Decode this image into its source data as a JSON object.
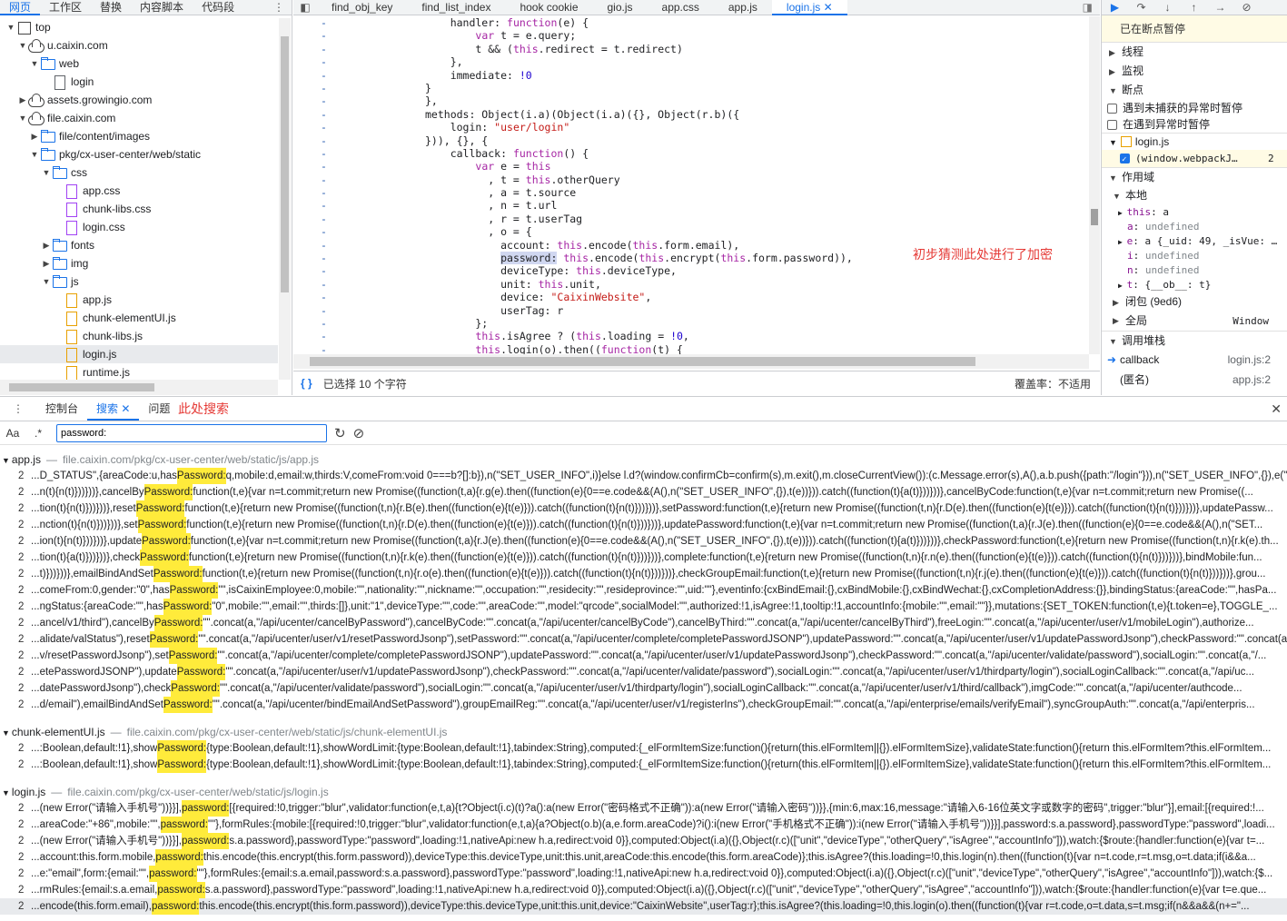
{
  "navigator": {
    "tabs": [
      "网页",
      "工作区",
      "替换",
      "内容脚本",
      "代码段"
    ],
    "active_tab": "网页",
    "tree": [
      {
        "label": "top",
        "depth": 0,
        "kind": "page",
        "expanded": true
      },
      {
        "label": "u.caixin.com",
        "depth": 1,
        "kind": "cloud",
        "expanded": true
      },
      {
        "label": "web",
        "depth": 2,
        "kind": "folder",
        "expanded": true
      },
      {
        "label": "login",
        "depth": 3,
        "kind": "file"
      },
      {
        "label": "assets.growingio.com",
        "depth": 1,
        "kind": "cloud",
        "expanded": false
      },
      {
        "label": "file.caixin.com",
        "depth": 1,
        "kind": "cloud",
        "expanded": true
      },
      {
        "label": "file/content/images",
        "depth": 2,
        "kind": "folder",
        "expanded": false
      },
      {
        "label": "pkg/cx-user-center/web/static",
        "depth": 2,
        "kind": "folder",
        "expanded": true
      },
      {
        "label": "css",
        "depth": 3,
        "kind": "folder",
        "expanded": true
      },
      {
        "label": "app.css",
        "depth": 4,
        "kind": "file-p"
      },
      {
        "label": "chunk-libs.css",
        "depth": 4,
        "kind": "file-p"
      },
      {
        "label": "login.css",
        "depth": 4,
        "kind": "file-p"
      },
      {
        "label": "fonts",
        "depth": 3,
        "kind": "folder",
        "expanded": false
      },
      {
        "label": "img",
        "depth": 3,
        "kind": "folder",
        "expanded": false
      },
      {
        "label": "js",
        "depth": 3,
        "kind": "folder",
        "expanded": true
      },
      {
        "label": "app.js",
        "depth": 4,
        "kind": "file-y"
      },
      {
        "label": "chunk-elementUI.js",
        "depth": 4,
        "kind": "file-y"
      },
      {
        "label": "chunk-libs.js",
        "depth": 4,
        "kind": "file-y"
      },
      {
        "label": "login.js",
        "depth": 4,
        "kind": "file-y",
        "selected": true
      },
      {
        "label": "runtime.js",
        "depth": 4,
        "kind": "file-y"
      }
    ]
  },
  "editor": {
    "tabs": [
      "find_obj_key",
      "find_list_index",
      "hook cookie",
      "gio.js",
      "app.css",
      "app.js",
      "login.js"
    ],
    "active_tab": "login.js",
    "code_lines": [
      {
        "text": "    handler: function(e) {"
      },
      {
        "text": "        var t = e.query;"
      },
      {
        "text": "        t && (this.redirect = t.redirect)"
      },
      {
        "text": "    },"
      },
      {
        "text": "    immediate: !0"
      },
      {
        "text": "}"
      },
      {
        "text": "},"
      },
      {
        "text": "methods: Object(i.a)(Object(i.a)({}, Object(r.b)({"
      },
      {
        "text": "    login: \"user/login\""
      },
      {
        "text": "})), {}, {"
      },
      {
        "text": "    callback: function() {"
      },
      {
        "text": "        var e = this"
      },
      {
        "text": "          , t = this.otherQuery"
      },
      {
        "text": "          , a = t.source"
      },
      {
        "text": "          , n = t.url"
      },
      {
        "text": "          , r = t.userTag"
      },
      {
        "text": "          , o = {"
      },
      {
        "text": "            account: this.encode(this.form.email),"
      },
      {
        "text": "            password: this.encode(this.encrypt(this.form.password)),"
      },
      {
        "text": "            deviceType: this.deviceType,"
      },
      {
        "text": "            unit: this.unit,"
      },
      {
        "text": "            device: \"CaixinWebsite\","
      },
      {
        "text": "            userTag: r"
      },
      {
        "text": "        };"
      },
      {
        "text": "        this.isAgree ? (this.loading = !0,"
      },
      {
        "text": "        this.login(o).then((function(t) {"
      }
    ],
    "annotation": "初步猜测此处进行了加密",
    "status_selected": "已选择 10 个字符",
    "status_coverage": "覆盖率：不适用"
  },
  "debugger": {
    "paused_label": "已在断点暂停",
    "sections": {
      "threads": "线程",
      "watch": "监视",
      "breakpoints": "断点",
      "pause_uncaught": "遇到未捕获的异常时暂停",
      "pause_caught": "在遇到异常时暂停",
      "bp_file": "login.js",
      "bp_code": "(window.webpackJ…",
      "bp_line": "2",
      "scope": "作用域",
      "local": "本地",
      "closure": "闭包 (9ed6)",
      "global": "全局",
      "global_value": "Window",
      "callstack": "调用堆栈"
    },
    "scope_vars": [
      {
        "key": "this",
        "value": "a",
        "expandable": true
      },
      {
        "key": "a",
        "value": "undefined"
      },
      {
        "key": "e",
        "value": "a {_uid: 49, _isVue: …",
        "expandable": true
      },
      {
        "key": "i",
        "value": "undefined"
      },
      {
        "key": "n",
        "value": "undefined"
      },
      {
        "key": "t",
        "value": "{__ob__: t}",
        "expandable": true
      }
    ],
    "stack": [
      {
        "fn": "callback",
        "loc": "login.js:2",
        "current": true
      },
      {
        "fn": "(匿名)",
        "loc": "app.js:2"
      }
    ]
  },
  "drawer": {
    "tabs": [
      "控制台",
      "搜索",
      "问题"
    ],
    "active_tab": "搜索",
    "annotation": "此处搜索",
    "search_case": "Aa",
    "search_regex": ".*",
    "search_query": "password:"
  },
  "results": [
    {
      "file": "app.js",
      "path": "file.caixin.com/pkg/cx-user-center/web/static/js/app.js",
      "lines": [
        {
          "n": "2",
          "pre": "...D_STATUS\",{areaCode:u,has",
          "match": "Password:",
          "post": "q,mobile:d,email:w,thirds:V,comeFrom:void 0===b?[]:b}),n(\"SET_USER_INFO\",i)}else l.d?(window.confirmCb=confirm(s),m.exit(),m.closeCurrentView()):(c.Message.error(s),A(),a.b.push({path:\"/login\"})),n(\"SET_USER_INFO\",{}),e(\"c..."
        },
        {
          "n": "2",
          "pre": "...n(t){n(t)}))}))},cancelBy",
          "match": "Password:",
          "post": "function(t,e){var n=t.commit;return new Promise((function(t,a){r.g(e).then((function(e){0==e.code&&(A(),n(\"SET_USER_INFO\",{}),t(e))})).catch((function(t){a(t)}))}))},cancelByCode:function(t,e){var n=t.commit;return new Promise((..."
        },
        {
          "n": "2",
          "pre": "...tion(t){n(t)}))}))},reset",
          "match": "Password:",
          "post": "function(t,e){return new Promise((function(t,n){r.B(e).then((function(e){t(e)})).catch((function(t){n(t)}))}))},setPassword:function(t,e){return new Promise((function(t,n){r.D(e).then((function(e){t(e)})).catch((function(t){n(t)}))}))},updatePassw..."
        },
        {
          "n": "2",
          "pre": "...nction(t){n(t)}))}))},set",
          "match": "Password:",
          "post": "function(t,e){return new Promise((function(t,n){r.D(e).then((function(e){t(e)})).catch((function(t){n(t)}))}))},updatePassword:function(t,e){var n=t.commit;return new Promise((function(t,a){r.J(e).then((function(e){0==e.code&&(A(),n(\"SET..."
        },
        {
          "n": "2",
          "pre": "...ion(t){n(t)}))}))},update",
          "match": "Password:",
          "post": "function(t,e){var n=t.commit;return new Promise((function(t,a){r.J(e).then((function(e){0==e.code&&(A(),n(\"SET_USER_INFO\",{}),t(e))})).catch((function(t){a(t)}))}))},checkPassword:function(t,e){return new Promise((function(t,n){r.k(e).th..."
        },
        {
          "n": "2",
          "pre": "...tion(t){a(t)}))}))},check",
          "match": "Password:",
          "post": "function(t,e){return new Promise((function(t,n){r.k(e).then((function(e){t(e)})).catch((function(t){n(t)}))}))},complete:function(t,e){return new Promise((function(t,n){r.n(e).then((function(e){t(e)})).catch((function(t){n(t)}))}))},bindMobile:fun..."
        },
        {
          "n": "2",
          "pre": "...t)}))}))},emailBindAndSet",
          "match": "Password:",
          "post": "function(t,e){return new Promise((function(t,n){r.o(e).then((function(e){t(e)})).catch((function(t){n(t)}))}))},checkGroupEmail:function(t,e){return new Promise((function(t,n){r.j(e).then((function(e){t(e)})).catch((function(t){n(t)}))}))},grou..."
        },
        {
          "n": "2",
          "pre": "...comeFrom:0,gender:\"0\",has",
          "match": "Password:",
          "post": "\"\",isCaixinEmployee:0,mobile:\"\",nationality:\"\",nickname:\"\",occupation:\"\",residecity:\"\",resideprovince:\"\",uid:\"\"},eventinfo:{cxBindEmail:{},cxBindMobile:{},cxBindWechat:{},cxCompletionAddress:{}},bindingStatus:{areaCode:\"\",hasPa..."
        },
        {
          "n": "2",
          "pre": "...ngStatus:{areaCode:\"\",has",
          "match": "Password:",
          "post": "\"0\",mobile:\"\",email:\"\",thirds:[]},unit:\"1\",deviceType:\"\",code:\"\",areaCode:\"\",model:\"qrcode\",socialModel:\"\",authorized:!1,isAgree:!1,tooltip:!1,accountInfo:{mobile:\"\",email:\"\"}},mutations:{SET_TOKEN:function(t,e){t.token=e},TOGGLE_..."
        },
        {
          "n": "2",
          "pre": "...ancel/v1/third\"),cancelBy",
          "match": "Password:",
          "post": "\"\".concat(a,\"/api/ucenter/cancelByPassword\"),cancelByCode:\"\".concat(a,\"/api/ucenter/cancelByCode\"),cancelByThird:\"\".concat(a,\"/api/ucenter/cancelByThird\"),freeLogin:\"\".concat(a,\"/api/ucenter/user/v1/mobileLogin\"),authorize..."
        },
        {
          "n": "2",
          "pre": "...alidate/valStatus\"),reset",
          "match": "Password:",
          "post": "\"\".concat(a,\"/api/ucenter/user/v1/resetPasswordJsonp\"),setPassword:\"\".concat(a,\"/api/ucenter/complete/completePasswordJSONP\"),updatePassword:\"\".concat(a,\"/api/ucenter/user/v1/updatePasswordJsonp\"),checkPassword:\"\".concat(a,..."
        },
        {
          "n": "2",
          "pre": "...v/resetPasswordJsonp\"),set",
          "match": "Password:",
          "post": "\"\".concat(a,\"/api/ucenter/complete/completePasswordJSONP\"),updatePassword:\"\".concat(a,\"/api/ucenter/user/v1/updatePasswordJsonp\"),checkPassword:\"\".concat(a,\"/api/ucenter/validate/password\"),socialLogin:\"\".concat(a,\"/..."
        },
        {
          "n": "2",
          "pre": "...etePasswordJSONP\"),update",
          "match": "Password:",
          "post": "\"\".concat(a,\"/api/ucenter/user/v1/updatePasswordJsonp\"),checkPassword:\"\".concat(a,\"/api/ucenter/validate/password\"),socialLogin:\"\".concat(a,\"/api/ucenter/user/v1/thirdparty/login\"),socialLoginCallback:\"\".concat(a,\"/api/uc..."
        },
        {
          "n": "2",
          "pre": "...datePasswordJsonp\"),check",
          "match": "Password:",
          "post": "\"\".concat(a,\"/api/ucenter/validate/password\"),socialLogin:\"\".concat(a,\"/api/ucenter/user/v1/thirdparty/login\"),socialLoginCallback:\"\".concat(a,\"/api/ucenter/user/v1/third/callback\"),imgCode:\"\".concat(a,\"/api/ucenter/authcode..."
        },
        {
          "n": "2",
          "pre": "...d/email\"),emailBindAndSet",
          "match": "Password:",
          "post": "\"\".concat(a,\"/api/ucenter/bindEmailAndSetPassword\"),groupEmailReg:\"\".concat(a,\"/api/ucenter/user/v1/registerIns\"),checkGroupEmail:\"\".concat(a,\"/api/enterprise/emails/verifyEmail\"),syncGroupAuth:\"\".concat(a,\"/api/enterpris..."
        }
      ]
    },
    {
      "file": "chunk-elementUI.js",
      "path": "file.caixin.com/pkg/cx-user-center/web/static/js/chunk-elementUI.js",
      "lines": [
        {
          "n": "2",
          "pre": "...:Boolean,default:!1},show",
          "match": "Password:",
          "post": "{type:Boolean,default:!1},showWordLimit:{type:Boolean,default:!1},tabindex:String},computed:{_elFormItemSize:function(){return(this.elFormItem||{}).elFormItemSize},validateState:function(){return this.elFormItem?this.elFormItem..."
        },
        {
          "n": "2",
          "pre": "...:Boolean,default:!1},show",
          "match": "Password:",
          "post": "{type:Boolean,default:!1},showWordLimit:{type:Boolean,default:!1},tabindex:String},computed:{_elFormItemSize:function(){return(this.elFormItem||{}).elFormItemSize},validateState:function(){return this.elFormItem?this.elFormItem..."
        }
      ]
    },
    {
      "file": "login.js",
      "path": "file.caixin.com/pkg/cx-user-center/web/static/js/login.js",
      "lines": [
        {
          "n": "2",
          "pre": "...(new Error(\"请输入手机号\"))}}],",
          "match": "password:",
          "post": "[{required:!0,trigger:\"blur\",validator:function(e,t,a){t?Object(i.c)(t)?a():a(new Error(\"密码格式不正确\")):a(new Error(\"请输入密码\"))}},{min:6,max:16,message:\"请输入6-16位英文字或数字的密码\",trigger:\"blur\"}],email:[{required:!..."
        },
        {
          "n": "2",
          "pre": "...areaCode:\"+86\",mobile:\"\",",
          "match": "password:",
          "post": "\"\"},formRules:{mobile:[{required:!0,trigger:\"blur\",validator:function(e,t,a){a?Object(o.b)(a,e.form.areaCode)?i():i(new Error(\"手机格式不正确\")):i(new Error(\"请输入手机号\"))}}],password:s.a.password},passwordType:\"password\",loadi..."
        },
        {
          "n": "2",
          "pre": "...(new Error(\"请输入手机号\"))}}],",
          "match": "password:",
          "post": "s.a.password},passwordType:\"password\",loading:!1,nativeApi:new h.a,redirect:void 0}},computed:Object(i.a)({},Object(r.c)([\"unit\",\"deviceType\",\"otherQuery\",\"isAgree\",\"accountInfo\"])),watch:{$route:{handler:function(e){var t=..."
        },
        {
          "n": "2",
          "pre": "...account:this.form.mobile,",
          "match": "password:",
          "post": "this.encode(this.encrypt(this.form.password)),deviceType:this.deviceType,unit:this.unit,areaCode:this.encode(this.form.areaCode)};this.isAgree?(this.loading=!0,this.login(n).then((function(t){var n=t.code,r=t.msg,o=t.data;if(i&&a..."
        },
        {
          "n": "2",
          "pre": "...e:\"email\",form:{email:\"\",",
          "match": "password:",
          "post": "\"\"},formRules:{email:s.a.email,password:s.a.password},passwordType:\"password\",loading:!1,nativeApi:new h.a,redirect:void 0}},computed:Object(i.a)({},Object(r.c)([\"unit\",\"deviceType\",\"otherQuery\",\"isAgree\",\"accountInfo\"])),watch:{$..."
        },
        {
          "n": "2",
          "pre": "...rmRules:{email:s.a.email,",
          "match": "password:",
          "post": "s.a.password},passwordType:\"password\",loading:!1,nativeApi:new h.a,redirect:void 0}},computed:Object(i.a)({},Object(r.c)([\"unit\",\"deviceType\",\"otherQuery\",\"isAgree\",\"accountInfo\"])),watch:{$route:{handler:function(e){var t=e.que..."
        },
        {
          "n": "2",
          "pre": "...encode(this.form.email),",
          "match": "password:",
          "post": "this.encode(this.encrypt(this.form.password)),deviceType:this.deviceType,unit:this.unit,device:\"CaixinWebsite\",userTag:r};this.isAgree?(this.loading=!0,this.login(o).then((function(t){var r=t.code,o=t.data,s=t.msg;if(n&&a&&(n+=\"...",
          "selected": true
        }
      ]
    }
  ]
}
